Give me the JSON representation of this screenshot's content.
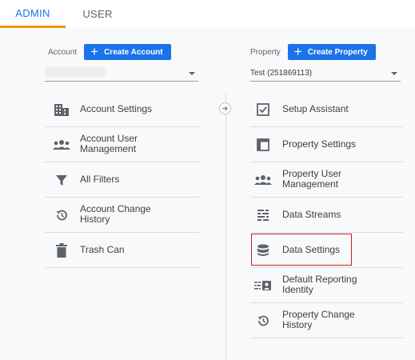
{
  "tabs": {
    "admin": "ADMIN",
    "user": "USER"
  },
  "account": {
    "label": "Account",
    "create_label": "Create Account",
    "select_value": "",
    "menu": [
      {
        "label": "Account Settings",
        "icon": "account-settings-icon"
      },
      {
        "label": "Account User Management",
        "icon": "people-icon"
      },
      {
        "label": "All Filters",
        "icon": "filter-icon"
      },
      {
        "label": "Account Change History",
        "icon": "history-icon"
      },
      {
        "label": "Trash Can",
        "icon": "trash-icon"
      }
    ]
  },
  "property": {
    "label": "Property",
    "create_label": "Create Property",
    "select_value": "Test (251869113)",
    "menu": [
      {
        "label": "Setup Assistant",
        "icon": "checkbox-icon"
      },
      {
        "label": "Property Settings",
        "icon": "property-settings-icon"
      },
      {
        "label": "Property User Management",
        "icon": "people-icon"
      },
      {
        "label": "Data Streams",
        "icon": "data-streams-icon"
      },
      {
        "label": "Data Settings",
        "icon": "database-icon"
      },
      {
        "label": "Default Reporting Identity",
        "icon": "reporting-identity-icon"
      },
      {
        "label": "Property Change History",
        "icon": "history-icon"
      }
    ]
  },
  "colors": {
    "accent": "#1a73e8",
    "tab_underline": "#f29900",
    "highlight": "#c5221f"
  }
}
